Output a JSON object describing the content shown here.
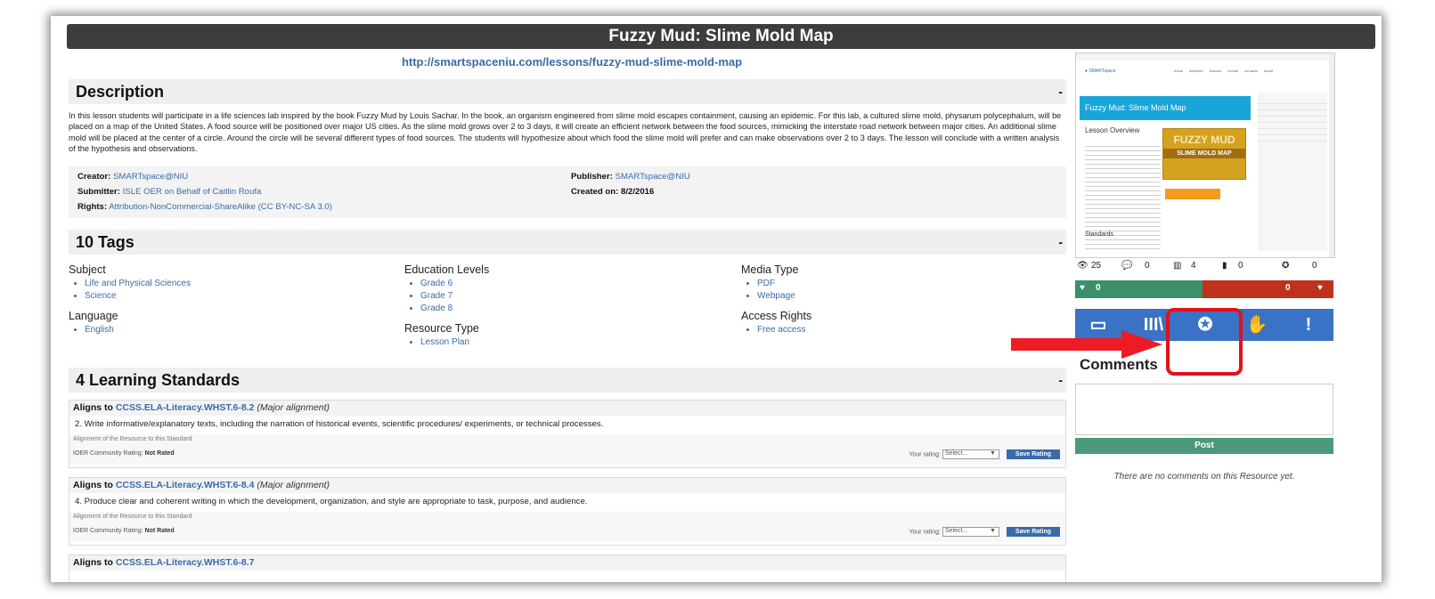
{
  "page": {
    "title": "Fuzzy Mud: Slime Mold Map",
    "url": "http://smartspaceniu.com/lessons/fuzzy-mud-slime-mold-map"
  },
  "description": {
    "heading": "Description",
    "collapse": "-",
    "text": "In this lesson students will participate in a life sciences lab inspired by the book Fuzzy Mud by Louis Sachar. In the book, an organism engineered from slime mold escapes containment, causing an epidemic. For this lab, a cultured slime mold, physarum polycephalum, will be placed on a map of the United States. A food source will be positioned over major US cities. As the slime mold grows over 2 to 3 days, it will create an efficient network between the food sources, mimicking the interstate road network between major cities. An additional slime mold will be placed at the center of a circle. Around the circle will be several different types of food sources. The students will hypothesize about which food the slime mold will prefer and can make observations over 2 to 3 days. The lesson will conclude with a written analysis of the hypothesis and observations."
  },
  "meta": {
    "creator_label": "Creator:",
    "creator": "SMARTspace@NIU",
    "submitter_label": "Submitter:",
    "submitter": "ISLE OER on Behalf of Caitlin Roufa",
    "rights_label": "Rights:",
    "rights": "Attribution-NonCommercial-ShareAlike (CC BY-NC-SA 3.0)",
    "publisher_label": "Publisher:",
    "publisher": "SMARTspace@NIU",
    "created_label": "Created on:",
    "created": "8/2/2016"
  },
  "tags": {
    "heading": "10  Tags",
    "collapse": "-",
    "subject": {
      "title": "Subject",
      "items": [
        "Life and Physical Sciences",
        "Science"
      ]
    },
    "language": {
      "title": "Language",
      "items": [
        "English"
      ]
    },
    "education_levels": {
      "title": "Education Levels",
      "items": [
        "Grade 6",
        "Grade 7",
        "Grade 8"
      ]
    },
    "resource_type": {
      "title": "Resource Type",
      "items": [
        "Lesson Plan"
      ]
    },
    "media_type": {
      "title": "Media Type",
      "items": [
        "PDF",
        "Webpage"
      ]
    },
    "access_rights": {
      "title": "Access Rights",
      "items": [
        "Free access"
      ]
    }
  },
  "standards": {
    "heading": "4   Learning Standards",
    "collapse": "-",
    "aligns_label": "Aligns to",
    "alignment_label": "Alignment of the Resource to this Standard",
    "community_label": "IOER Community Rating:",
    "your_rating_label": "Your rating:",
    "select_placeholder": "Select...",
    "save_label": "Save Rating",
    "items": [
      {
        "code": "CCSS.ELA-Literacy.WHST.6-8.2",
        "alignment": "(Major alignment)",
        "text": "2. Write informative/explanatory texts, including the narration of historical events, scientific procedures/ experiments, or technical processes.",
        "rating": "Not Rated"
      },
      {
        "code": "CCSS.ELA-Literacy.WHST.6-8.4",
        "alignment": "(Major alignment)",
        "text": "4. Produce clear and coherent writing in which the development, organization, and style are appropriate to task, purpose, and audience.",
        "rating": "Not Rated"
      },
      {
        "code": "CCSS.ELA-Literacy.WHST.6-8.7"
      }
    ]
  },
  "preview": {
    "banner": "Fuzzy Mud: Slime Mold Map",
    "overview": "Lesson Overview",
    "poster_title": "FUZZY MUD",
    "poster_sub": "SLIME MOLD MAP",
    "standards": "Standards"
  },
  "stats": {
    "views": "25",
    "comments": "0",
    "library": "4",
    "downloads": "0",
    "awards": "0",
    "likes": "0",
    "dislikes": "0"
  },
  "colors": {
    "accent": "#3a72c5",
    "like": "#3c8f6b",
    "dislike": "#c0311c",
    "highlight": "#e5101c"
  },
  "comments": {
    "heading": "Comments",
    "post_label": "Post",
    "empty": "There are no comments on this Resource yet."
  }
}
